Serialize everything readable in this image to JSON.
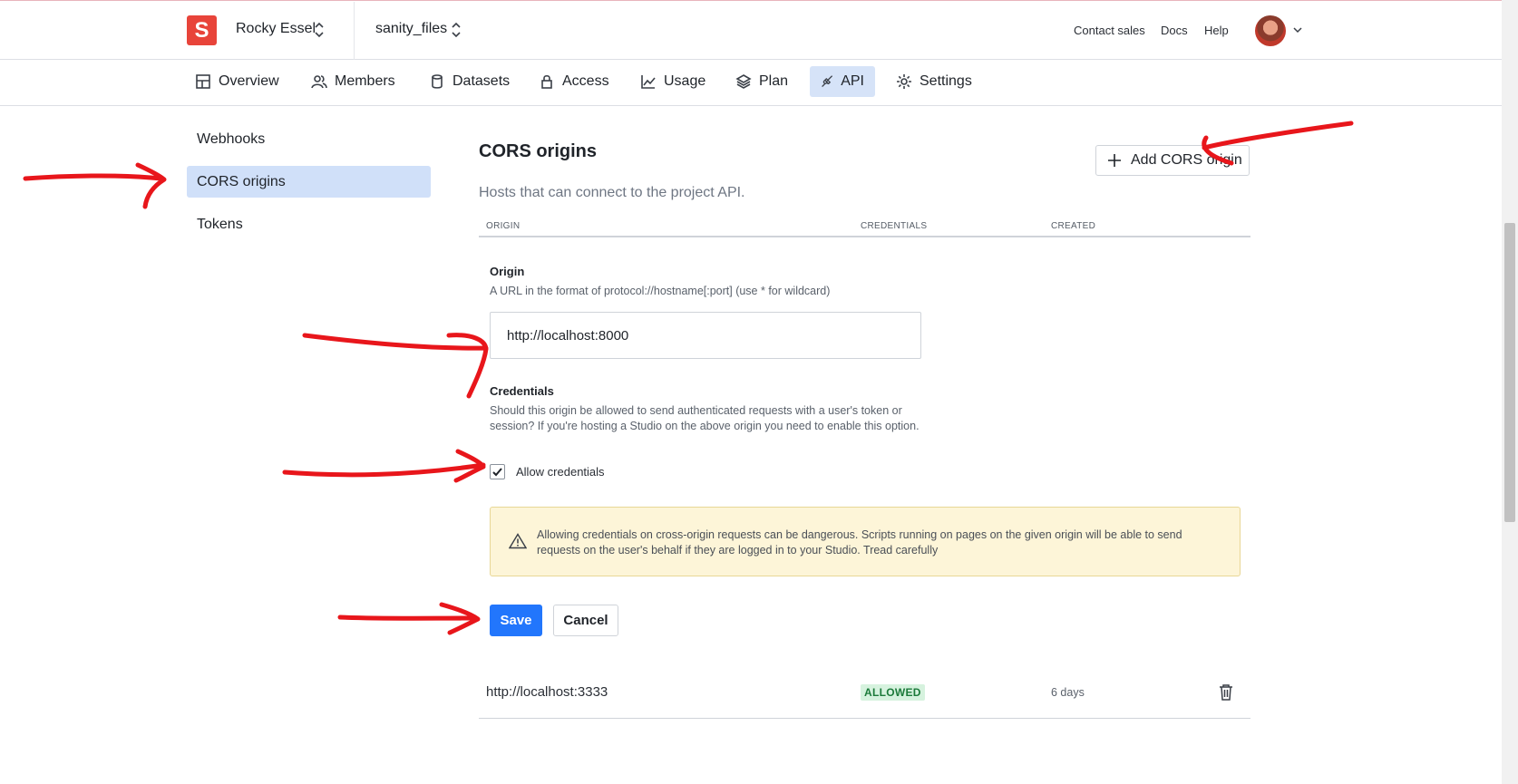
{
  "header": {
    "logo_letter": "S",
    "org_name": "Rocky Essel",
    "project_name": "sanity_files",
    "links": [
      "Contact sales",
      "Docs",
      "Help"
    ]
  },
  "tabs": [
    {
      "label": "Overview",
      "icon": "overview-icon"
    },
    {
      "label": "Members",
      "icon": "members-icon"
    },
    {
      "label": "Datasets",
      "icon": "datasets-icon"
    },
    {
      "label": "Access",
      "icon": "lock-icon"
    },
    {
      "label": "Usage",
      "icon": "usage-chart-icon"
    },
    {
      "label": "Plan",
      "icon": "plan-layers-icon"
    },
    {
      "label": "API",
      "icon": "api-plug-icon",
      "active": true
    },
    {
      "label": "Settings",
      "icon": "gear-icon"
    }
  ],
  "sidenav": {
    "items": [
      {
        "label": "Webhooks"
      },
      {
        "label": "CORS origins",
        "active": true
      },
      {
        "label": "Tokens"
      }
    ]
  },
  "cors": {
    "title": "CORS origins",
    "subtitle": "Hosts that can connect to the project API.",
    "add_button": "Add CORS origin",
    "columns": [
      "ORIGIN",
      "CREDENTIALS",
      "CREATED"
    ],
    "form": {
      "origin_label": "Origin",
      "origin_help": "A URL in the format of protocol://hostname[:port] (use * for wildcard)",
      "origin_value": "http://localhost:8000",
      "credentials_label": "Credentials",
      "credentials_help": "Should this origin be allowed to send authenticated requests with a user's token or session? If you're hosting a Studio on the above origin you need to enable this option.",
      "checkbox_label": "Allow credentials",
      "checkbox_checked": true,
      "warning": "Allowing credentials on cross-origin requests can be dangerous. Scripts running on pages on the given origin will be able to send requests on the user's behalf if they are logged in to your Studio. Tread carefully",
      "save_label": "Save",
      "cancel_label": "Cancel"
    },
    "rows": [
      {
        "origin": "http://localhost:3333",
        "credentials": "ALLOWED",
        "created": "6 days"
      }
    ]
  },
  "colors": {
    "accent": "#2276fc",
    "brand": "#e8443a",
    "active_tab_bg": "#d6e3f8",
    "warning_bg": "#fdf5d8",
    "allowed_badge": "#d6f2de",
    "annotation": "#e8161b"
  }
}
